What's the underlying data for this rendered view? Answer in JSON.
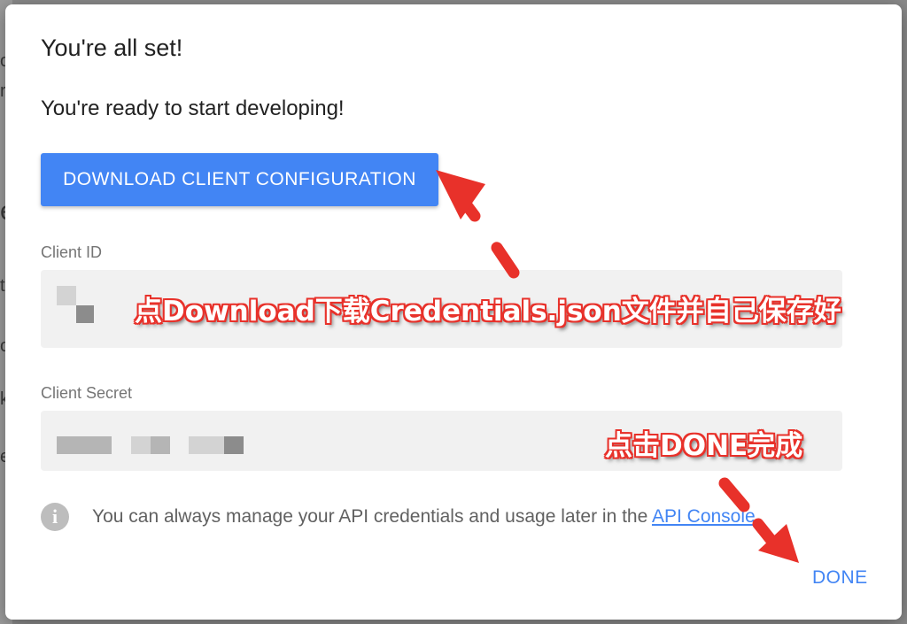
{
  "dialog": {
    "title": "You're all set!",
    "subtitle": "You're ready to start developing!",
    "download_button_label": "DOWNLOAD CLIENT CONFIGURATION",
    "client_id_label": "Client ID",
    "client_secret_label": "Client Secret",
    "info_text_before_link": "You can always manage your API credentials and usage later in the ",
    "info_link_label": "API Console",
    "info_text_after_link": ".",
    "done_button_label": "DONE"
  },
  "annotations": {
    "download_note": "点Download下载Credentials.json文件并自己保存好",
    "done_note": "点击DONE完成"
  },
  "icons": {
    "info": "info-icon"
  },
  "colors": {
    "accent": "#4285f4",
    "annotation": "#e8312a"
  }
}
